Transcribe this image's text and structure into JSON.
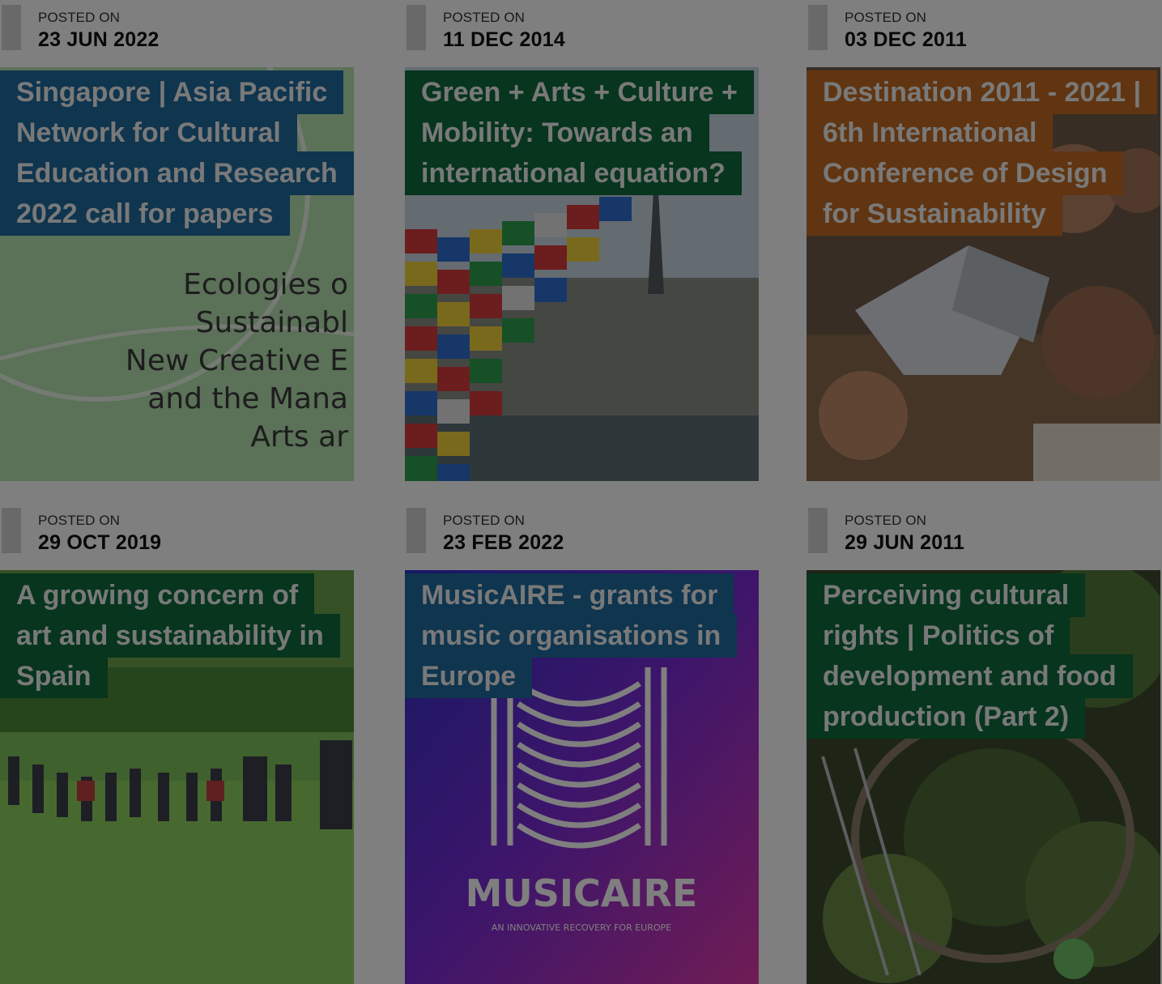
{
  "posts": [
    {
      "posted_label": "POSTED ON",
      "date": "23 JUN 2022",
      "title": "Singapore | Asia Pacific Network for Cultural Education and Research 2022 call for papers",
      "image_text": [
        "Ecologies o",
        "Sustainabl",
        "New Creative E",
        "and the Mana",
        "Arts ar"
      ],
      "accent": "#1f6b9e"
    },
    {
      "posted_label": "POSTED ON",
      "date": "11 DEC 2014",
      "title": "Green + Arts + Culture + Mobility: Towards an international equation?",
      "accent": "#0e6b3c"
    },
    {
      "posted_label": "POSTED ON",
      "date": "03 DEC 2011",
      "title": "Destination 2011 - 2021 | 6th International Conference of Design for Sustainability",
      "accent": "#c26b23"
    },
    {
      "posted_label": "POSTED ON",
      "date": "29 OCT 2019",
      "title": "A growing concern of art and sustainability in Spain",
      "accent": "#0e6b3c"
    },
    {
      "posted_label": "POSTED ON",
      "date": "23 FEB 2022",
      "title": "MusicAIRE - grants for music organisations in Europe",
      "image_text": [
        "MUSICAIRE",
        "AN INNOVATIVE RECOVERY FOR EUROPE"
      ],
      "accent": "#1f6b9e"
    },
    {
      "posted_label": "POSTED ON",
      "date": "29 JUN 2011",
      "title": "Perceiving cultural rights | Politics of development and food production (Part 2)",
      "accent": "#0e6b3c"
    }
  ],
  "overlay_color": "#000000"
}
